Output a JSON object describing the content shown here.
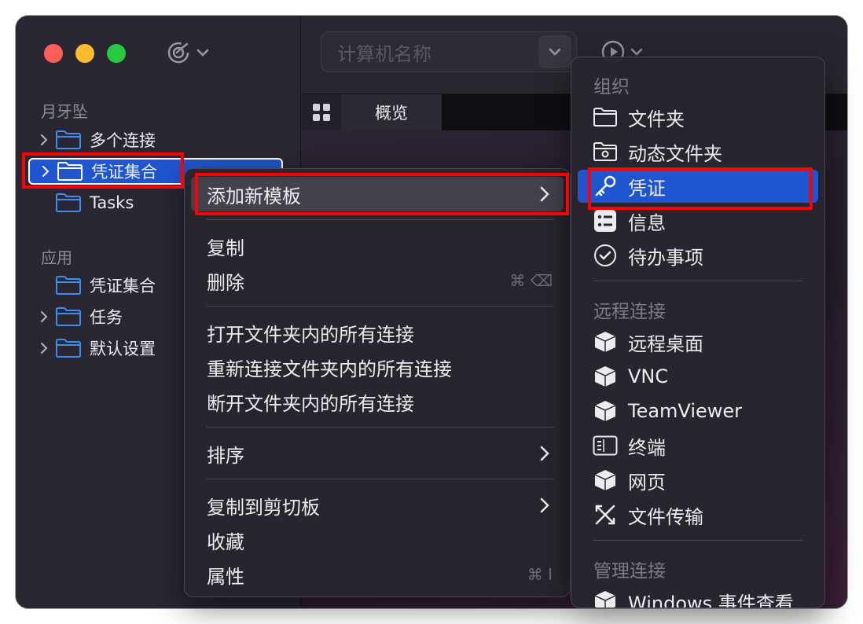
{
  "sidebar": {
    "section1": "月牙坠",
    "section2": "应用",
    "items": [
      {
        "label": "多个连接"
      },
      {
        "label": "凭证集合"
      },
      {
        "label": "Tasks"
      },
      {
        "label": "凭证集合"
      },
      {
        "label": "任务"
      },
      {
        "label": "默认设置"
      }
    ]
  },
  "toolbar": {
    "search_placeholder": "计算机名称"
  },
  "tabs": {
    "overview": "概览"
  },
  "context_menu": {
    "add_template": "添加新模板",
    "copy": "复制",
    "delete": "删除",
    "delete_shortcut": "⌘ ⌫",
    "open_all": "打开文件夹内的所有连接",
    "reconnect_all": "重新连接文件夹内的所有连接",
    "disconnect_all": "断开文件夹内的所有连接",
    "sort": "排序",
    "copy_clipboard": "复制到剪切板",
    "favorite": "收藏",
    "properties": "属性",
    "properties_shortcut": "⌘ I"
  },
  "submenu": {
    "org_header": "组织",
    "folder": "文件夹",
    "dynamic_folder": "动态文件夹",
    "credential": "凭证",
    "info": "信息",
    "todo": "待办事项",
    "remote_header": "远程连接",
    "remote_desktop": "远程桌面",
    "vnc": "VNC",
    "teamviewer": "TeamViewer",
    "terminal": "终端",
    "webpage": "网页",
    "file_transfer": "文件传输",
    "manage_header": "管理连接",
    "windows_event": "Windows 事件查看"
  },
  "colors": {
    "accent": "#1f56cf",
    "highlight": "#ff0000",
    "folder": "#3b8ef0"
  }
}
